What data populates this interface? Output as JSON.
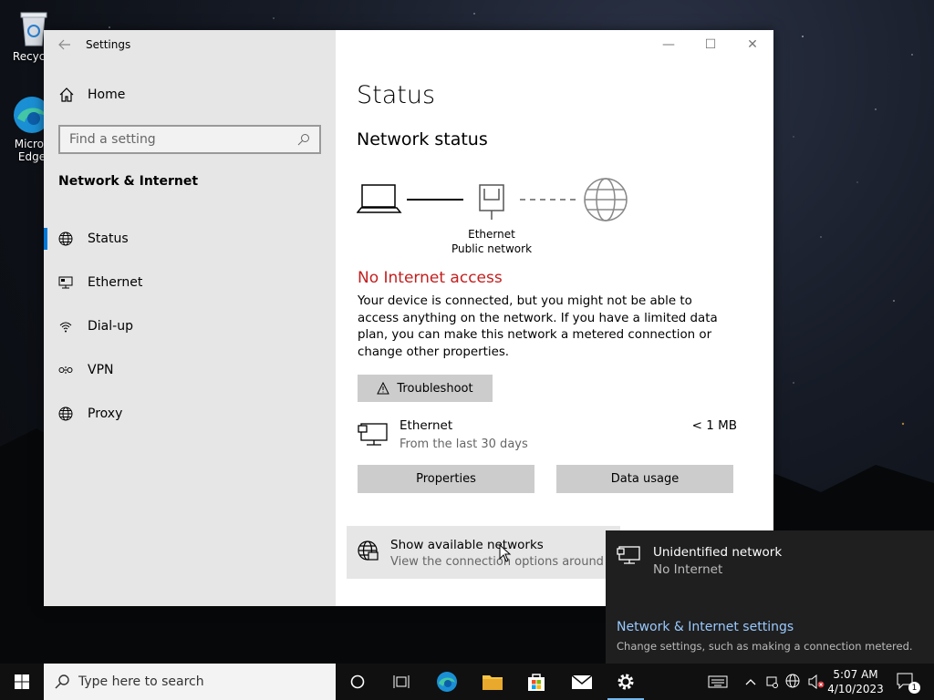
{
  "desktop": {
    "icons": [
      {
        "label": "Recycle",
        "icon": "recycle-bin-icon"
      },
      {
        "label": "Micros\nEdge",
        "icon": "edge-icon"
      }
    ]
  },
  "window": {
    "title": "Settings",
    "controls": {
      "minimize": "—",
      "maximize": "☐",
      "close": "✕"
    }
  },
  "sidebar": {
    "home_label": "Home",
    "search_placeholder": "Find a setting",
    "section_title": "Network & Internet",
    "items": [
      {
        "label": "Status",
        "icon": "globe-icon",
        "active": true
      },
      {
        "label": "Ethernet",
        "icon": "ethernet-icon",
        "active": false
      },
      {
        "label": "Dial-up",
        "icon": "dialup-icon",
        "active": false
      },
      {
        "label": "VPN",
        "icon": "vpn-icon",
        "active": false
      },
      {
        "label": "Proxy",
        "icon": "globe-icon",
        "active": false
      }
    ]
  },
  "main": {
    "page_title": "Status",
    "subtitle": "Network status",
    "diagram": {
      "adapter_name": "Ethernet",
      "network_type": "Public network"
    },
    "alert_title": "No Internet access",
    "alert_text": "Your device is connected, but you might not be able to access anything on the network. If you have a limited data plan, you can make this network a metered connection or change other properties.",
    "troubleshoot_label": "Troubleshoot",
    "connection": {
      "name": "Ethernet",
      "period": "From the last 30 days",
      "usage": "< 1 MB"
    },
    "properties_label": "Properties",
    "data_usage_label": "Data usage",
    "show_networks": {
      "title": "Show available networks",
      "subtitle": "View the connection options around you."
    }
  },
  "flyout": {
    "network_name": "Unidentified network",
    "network_status": "No Internet",
    "settings_link": "Network & Internet settings",
    "settings_hint": "Change settings, such as making a connection metered."
  },
  "taskbar": {
    "search_placeholder": "Type here to search",
    "time": "5:07 AM",
    "date": "4/10/2023",
    "notification_count": "1"
  },
  "colors": {
    "accent": "#0078d7",
    "alert": "#c41e1e",
    "link": "#99c9ff"
  }
}
